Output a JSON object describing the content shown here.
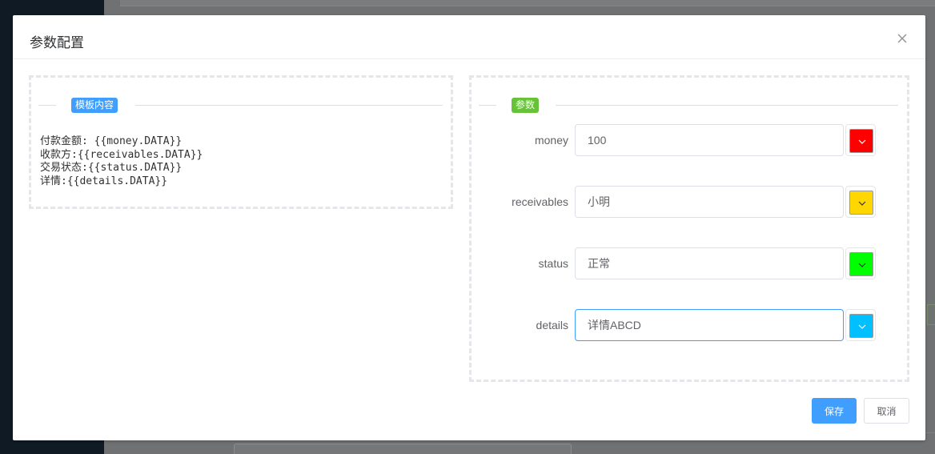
{
  "dialog": {
    "title": "参数配置",
    "save_label": "保存",
    "cancel_label": "取消"
  },
  "template_panel": {
    "tag": "模板内容",
    "lines": [
      "付款金额: {{money.DATA}}",
      "收款方:{{receivables.DATA}}",
      "交易状态:{{status.DATA}}",
      "详情:{{details.DATA}}"
    ]
  },
  "params_panel": {
    "tag": "参数",
    "params": [
      {
        "label": "money",
        "value": "100",
        "color": "#ff0000"
      },
      {
        "label": "receivables",
        "value": "小明",
        "color": "#ffd700"
      },
      {
        "label": "status",
        "value": "正常",
        "color": "#00ff00"
      },
      {
        "label": "details",
        "value": "详情ABCD",
        "color": "#00c0ff",
        "focused": true
      }
    ]
  },
  "colors": {
    "primary": "#409eff",
    "tag_green": "#67c23a"
  },
  "icons": {
    "close": "close-icon",
    "picker": "chevron-down-icon"
  }
}
